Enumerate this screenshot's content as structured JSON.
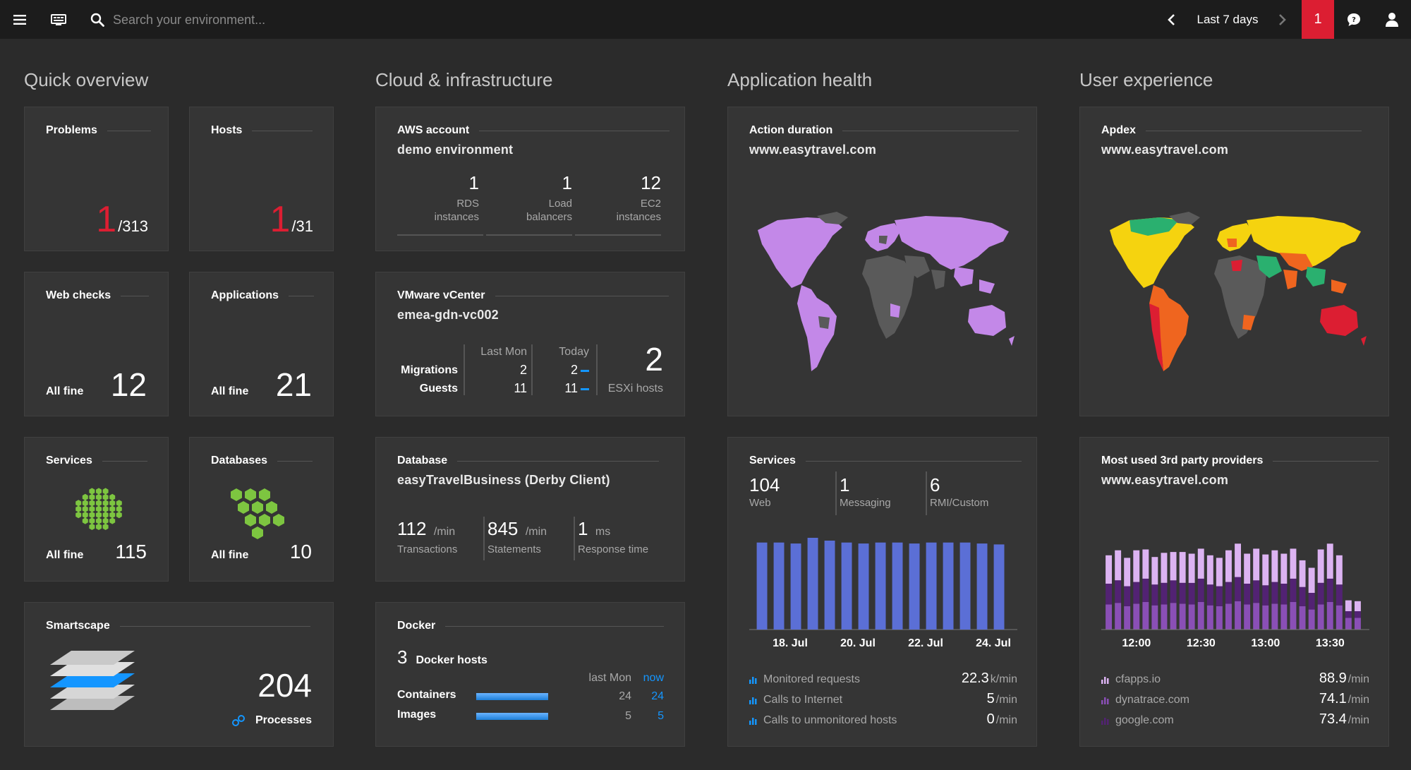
{
  "topbar": {
    "search_placeholder": "Search your environment...",
    "timeframe": "Last 7 days",
    "alert_count": "1"
  },
  "sections": {
    "quick": "Quick overview",
    "cloud": "Cloud & infrastructure",
    "app": "Application health",
    "ux": "User experience"
  },
  "quick": {
    "problems": {
      "title": "Problems",
      "count": "1",
      "total": "/313"
    },
    "hosts": {
      "title": "Hosts",
      "count": "1",
      "total": "/31"
    },
    "webchecks": {
      "title": "Web checks",
      "status": "All fine",
      "count": "12"
    },
    "applications": {
      "title": "Applications",
      "status": "All fine",
      "count": "21"
    },
    "services": {
      "title": "Services",
      "status": "All fine",
      "count": "115"
    },
    "databases": {
      "title": "Databases",
      "status": "All fine",
      "count": "10"
    },
    "smartscape": {
      "title": "Smartscape",
      "count": "204",
      "label": "Processes"
    }
  },
  "cloud": {
    "aws": {
      "title": "AWS account",
      "name": "demo environment",
      "stats": [
        {
          "value": "1",
          "line1": "RDS",
          "line2": "instances"
        },
        {
          "value": "1",
          "line1": "Load",
          "line2": "balancers"
        },
        {
          "value": "12",
          "line1": "EC2",
          "line2": "instances"
        }
      ]
    },
    "vmware": {
      "title": "VMware vCenter",
      "name": "emea-gdn-vc002",
      "col_last": "Last Mon",
      "col_today": "Today",
      "rows": [
        {
          "label": "Migrations",
          "last": "2",
          "today": "2"
        },
        {
          "label": "Guests",
          "last": "11",
          "today": "11"
        }
      ],
      "hosts_count": "2",
      "hosts_label": "ESXi hosts"
    },
    "database": {
      "title": "Database",
      "name": "easyTravelBusiness (Derby Client)",
      "stats": [
        {
          "value": "112",
          "unit": "/min",
          "label": "Transactions"
        },
        {
          "value": "845",
          "unit": "/min",
          "label": "Statements"
        },
        {
          "value": "1",
          "unit": "ms",
          "label": "Response time"
        }
      ]
    },
    "docker": {
      "title": "Docker",
      "hosts_count": "3",
      "hosts_label": "Docker hosts",
      "col_last": "last Mon",
      "col_now": "now",
      "rows": [
        {
          "label": "Containers",
          "last": "24",
          "now": "24",
          "fill": 1.0
        },
        {
          "label": "Images",
          "last": "5",
          "now": "5",
          "fill": 1.0
        }
      ]
    }
  },
  "app": {
    "action": {
      "title": "Action duration",
      "site": "www.easytravel.com"
    },
    "services": {
      "title": "Services",
      "stats": [
        {
          "value": "104",
          "label": "Web"
        },
        {
          "value": "1",
          "label": "Messaging"
        },
        {
          "value": "6",
          "label": "RMI/Custom"
        }
      ],
      "chart_data": {
        "type": "bar",
        "values": [
          92,
          92,
          91,
          97,
          94,
          92,
          91,
          92,
          92,
          91,
          92,
          92,
          92,
          91,
          90
        ],
        "x_ticks": [
          "18. Jul",
          "20. Jul",
          "22. Jul",
          "24. Jul"
        ]
      },
      "metrics": [
        {
          "label": "Monitored requests",
          "value": "22.3",
          "unit": "k/min"
        },
        {
          "label": "Calls to Internet",
          "value": "5",
          "unit": "/min"
        },
        {
          "label": "Calls to unmonitored hosts",
          "value": "0",
          "unit": "/min"
        }
      ]
    }
  },
  "ux": {
    "apdex": {
      "title": "Apdex",
      "site": "www.easytravel.com"
    },
    "providers": {
      "title": "Most used 3rd party providers",
      "site": "www.easytravel.com",
      "chart_data": {
        "type": "bar",
        "stacked": true,
        "series": [
          {
            "values": [
              30,
              32,
              28,
              31,
              33,
              29,
              30,
              32,
              31,
              30,
              33,
              29,
              28,
              31,
              34,
              30,
              32,
              29,
              31,
              30,
              33,
              28,
              24,
              30,
              33,
              29,
              14,
              14
            ]
          },
          {
            "values": [
              25,
              27,
              24,
              26,
              28,
              25,
              26,
              27,
              25,
              26,
              28,
              25,
              24,
              26,
              29,
              25,
              27,
              24,
              26,
              25,
              28,
              23,
              20,
              26,
              28,
              25,
              8,
              8
            ]
          },
          {
            "values": [
              34,
              36,
              34,
              38,
              35,
              33,
              36,
              34,
              37,
              35,
              36,
              35,
              34,
              38,
              40,
              36,
              38,
              37,
              38,
              36,
              36,
              32,
              30,
              40,
              42,
              35,
              13,
              12
            ]
          }
        ],
        "x_ticks": [
          "12:00",
          "12:30",
          "13:00",
          "13:30"
        ]
      },
      "metrics": [
        {
          "label": "cfapps.io",
          "value": "88.9",
          "unit": "/min"
        },
        {
          "label": "dynatrace.com",
          "value": "74.1",
          "unit": "/min"
        },
        {
          "label": "google.com",
          "value": "73.4",
          "unit": "/min"
        }
      ]
    }
  },
  "colors": {
    "problem": "#dc1e32",
    "accent_blue": "#1496ff",
    "services_bar": "#5b6fd6",
    "green_hex": "#7dc540",
    "map_purple": "#c388e8",
    "map_gray": "#5a5a5a",
    "apdex_yellow": "#f5d30f",
    "apdex_orange": "#ef651f",
    "apdex_red": "#dc1e32",
    "apdex_green": "#2ab06f",
    "prov_dark": "#522273",
    "prov_mid": "#8a4fb6",
    "prov_light": "#dcb3f2"
  }
}
